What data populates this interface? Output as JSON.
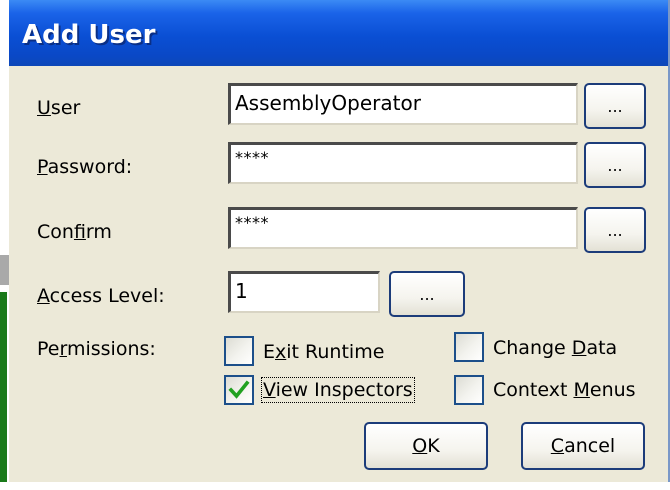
{
  "window": {
    "title": "Add User"
  },
  "fields": {
    "user": {
      "label_pre": "",
      "label_ul": "U",
      "label_post": "ser",
      "value": "AssemblyOperator",
      "browse_label": "..."
    },
    "password": {
      "label_pre": "",
      "label_ul": "P",
      "label_post": "assword:",
      "value": "****",
      "browse_label": "..."
    },
    "confirm": {
      "label_pre": "Con",
      "label_ul": "f",
      "label_post": "irm",
      "value": "****",
      "browse_label": "..."
    },
    "access_level": {
      "label_pre": "",
      "label_ul": "A",
      "label_post": "ccess Level:",
      "value": "1",
      "browse_label": "..."
    }
  },
  "permissions": {
    "label_pre": "Pe",
    "label_ul": "r",
    "label_post": "missions:",
    "items": [
      {
        "pre": "E",
        "ul": "x",
        "post": "it Runtime",
        "checked": false
      },
      {
        "pre": "",
        "ul": "V",
        "post": "iew Inspectors",
        "checked": true
      },
      {
        "pre": "Change ",
        "ul": "D",
        "post": "ata",
        "checked": false
      },
      {
        "pre": "Context ",
        "ul": "M",
        "post": "enus",
        "checked": false
      }
    ]
  },
  "buttons": {
    "ok": {
      "ul": "O",
      "post": "K"
    },
    "cancel": {
      "ul": "C",
      "post": "ancel"
    }
  },
  "colors": {
    "title_bar": "#0a4fd4",
    "dialog_bg": "#ece9d8",
    "check_mark": "#21a121"
  }
}
